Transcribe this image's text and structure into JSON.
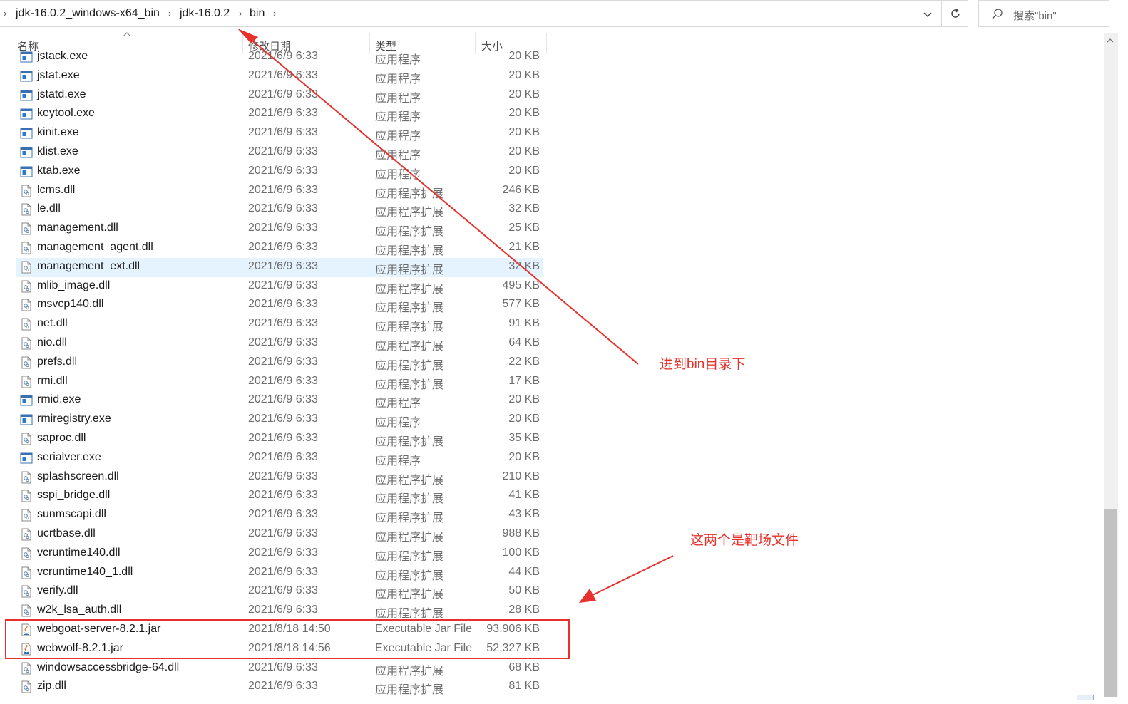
{
  "address_bar": {
    "breadcrumbs": [
      "jdk-16.0.2_windows-x64_bin",
      "jdk-16.0.2",
      "bin"
    ]
  },
  "search": {
    "placeholder": "搜索\"bin\""
  },
  "columns": {
    "name": "名称",
    "date": "修改日期",
    "type": "类型",
    "size": "大小"
  },
  "files": [
    {
      "name": "jstack.exe",
      "date": "2021/6/9 6:33",
      "type": "应用程序",
      "size": "20 KB",
      "icon": "exe-icon"
    },
    {
      "name": "jstat.exe",
      "date": "2021/6/9 6:33",
      "type": "应用程序",
      "size": "20 KB",
      "icon": "exe-icon"
    },
    {
      "name": "jstatd.exe",
      "date": "2021/6/9 6:33",
      "type": "应用程序",
      "size": "20 KB",
      "icon": "exe-icon"
    },
    {
      "name": "keytool.exe",
      "date": "2021/6/9 6:33",
      "type": "应用程序",
      "size": "20 KB",
      "icon": "exe-icon"
    },
    {
      "name": "kinit.exe",
      "date": "2021/6/9 6:33",
      "type": "应用程序",
      "size": "20 KB",
      "icon": "exe-icon"
    },
    {
      "name": "klist.exe",
      "date": "2021/6/9 6:33",
      "type": "应用程序",
      "size": "20 KB",
      "icon": "exe-icon"
    },
    {
      "name": "ktab.exe",
      "date": "2021/6/9 6:33",
      "type": "应用程序",
      "size": "20 KB",
      "icon": "exe-icon"
    },
    {
      "name": "lcms.dll",
      "date": "2021/6/9 6:33",
      "type": "应用程序扩展",
      "size": "246 KB",
      "icon": "dll-icon"
    },
    {
      "name": "le.dll",
      "date": "2021/6/9 6:33",
      "type": "应用程序扩展",
      "size": "32 KB",
      "icon": "dll-icon"
    },
    {
      "name": "management.dll",
      "date": "2021/6/9 6:33",
      "type": "应用程序扩展",
      "size": "25 KB",
      "icon": "dll-icon"
    },
    {
      "name": "management_agent.dll",
      "date": "2021/6/9 6:33",
      "type": "应用程序扩展",
      "size": "21 KB",
      "icon": "dll-icon"
    },
    {
      "name": "management_ext.dll",
      "date": "2021/6/9 6:33",
      "type": "应用程序扩展",
      "size": "32 KB",
      "icon": "dll-icon",
      "selected": true
    },
    {
      "name": "mlib_image.dll",
      "date": "2021/6/9 6:33",
      "type": "应用程序扩展",
      "size": "495 KB",
      "icon": "dll-icon"
    },
    {
      "name": "msvcp140.dll",
      "date": "2021/6/9 6:33",
      "type": "应用程序扩展",
      "size": "577 KB",
      "icon": "dll-icon"
    },
    {
      "name": "net.dll",
      "date": "2021/6/9 6:33",
      "type": "应用程序扩展",
      "size": "91 KB",
      "icon": "dll-icon"
    },
    {
      "name": "nio.dll",
      "date": "2021/6/9 6:33",
      "type": "应用程序扩展",
      "size": "64 KB",
      "icon": "dll-icon"
    },
    {
      "name": "prefs.dll",
      "date": "2021/6/9 6:33",
      "type": "应用程序扩展",
      "size": "22 KB",
      "icon": "dll-icon"
    },
    {
      "name": "rmi.dll",
      "date": "2021/6/9 6:33",
      "type": "应用程序扩展",
      "size": "17 KB",
      "icon": "dll-icon"
    },
    {
      "name": "rmid.exe",
      "date": "2021/6/9 6:33",
      "type": "应用程序",
      "size": "20 KB",
      "icon": "exe-icon"
    },
    {
      "name": "rmiregistry.exe",
      "date": "2021/6/9 6:33",
      "type": "应用程序",
      "size": "20 KB",
      "icon": "exe-icon"
    },
    {
      "name": "saproc.dll",
      "date": "2021/6/9 6:33",
      "type": "应用程序扩展",
      "size": "35 KB",
      "icon": "dll-icon"
    },
    {
      "name": "serialver.exe",
      "date": "2021/6/9 6:33",
      "type": "应用程序",
      "size": "20 KB",
      "icon": "exe-icon"
    },
    {
      "name": "splashscreen.dll",
      "date": "2021/6/9 6:33",
      "type": "应用程序扩展",
      "size": "210 KB",
      "icon": "dll-icon"
    },
    {
      "name": "sspi_bridge.dll",
      "date": "2021/6/9 6:33",
      "type": "应用程序扩展",
      "size": "41 KB",
      "icon": "dll-icon"
    },
    {
      "name": "sunmscapi.dll",
      "date": "2021/6/9 6:33",
      "type": "应用程序扩展",
      "size": "43 KB",
      "icon": "dll-icon"
    },
    {
      "name": "ucrtbase.dll",
      "date": "2021/6/9 6:33",
      "type": "应用程序扩展",
      "size": "988 KB",
      "icon": "dll-icon"
    },
    {
      "name": "vcruntime140.dll",
      "date": "2021/6/9 6:33",
      "type": "应用程序扩展",
      "size": "100 KB",
      "icon": "dll-icon"
    },
    {
      "name": "vcruntime140_1.dll",
      "date": "2021/6/9 6:33",
      "type": "应用程序扩展",
      "size": "44 KB",
      "icon": "dll-icon"
    },
    {
      "name": "verify.dll",
      "date": "2021/6/9 6:33",
      "type": "应用程序扩展",
      "size": "50 KB",
      "icon": "dll-icon"
    },
    {
      "name": "w2k_lsa_auth.dll",
      "date": "2021/6/9 6:33",
      "type": "应用程序扩展",
      "size": "28 KB",
      "icon": "dll-icon"
    },
    {
      "name": "webgoat-server-8.2.1.jar",
      "date": "2021/8/18 14:50",
      "type": "Executable Jar File",
      "size": "93,906 KB",
      "icon": "java-jar-icon"
    },
    {
      "name": "webwolf-8.2.1.jar",
      "date": "2021/8/18 14:56",
      "type": "Executable Jar File",
      "size": "52,327 KB",
      "icon": "java-jar-icon"
    },
    {
      "name": "windowsaccessbridge-64.dll",
      "date": "2021/6/9 6:33",
      "type": "应用程序扩展",
      "size": "68 KB",
      "icon": "dll-icon"
    },
    {
      "name": "zip.dll",
      "date": "2021/6/9 6:33",
      "type": "应用程序扩展",
      "size": "81 KB",
      "icon": "dll-icon"
    }
  ],
  "annotations": {
    "bin_note": "进到bin目录下",
    "target_note": "这两个是靶场文件",
    "color": "#e8312c"
  }
}
